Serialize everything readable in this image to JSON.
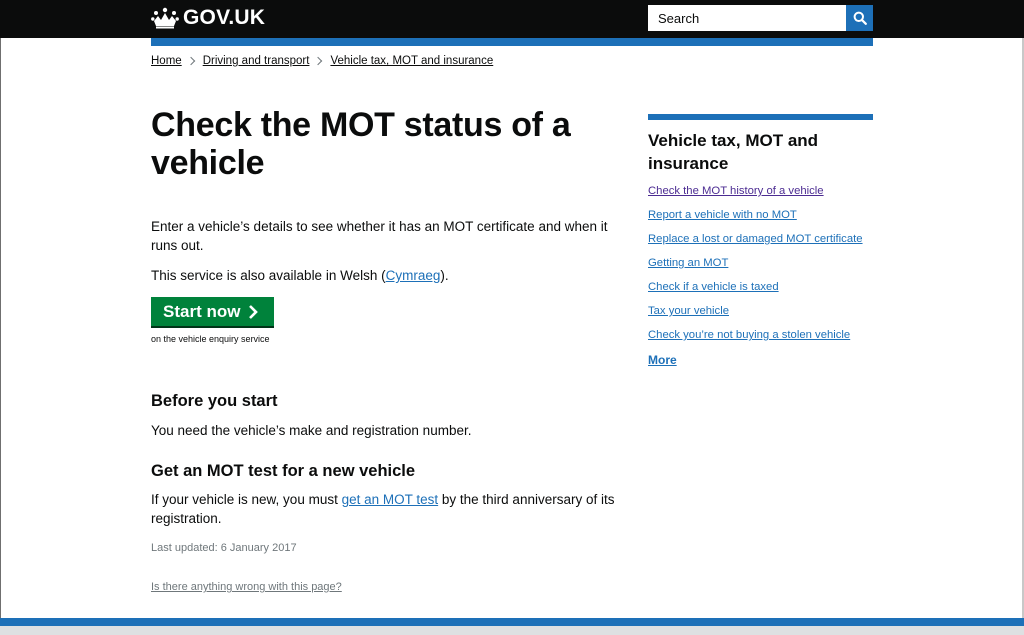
{
  "header": {
    "logo_text": "GOV.UK",
    "search_placeholder": "Search"
  },
  "breadcrumb": [
    "Home",
    "Driving and transport",
    "Vehicle tax, MOT and insurance"
  ],
  "main": {
    "title": "Check the MOT status of a vehicle",
    "intro": "Enter a vehicle’s details to see whether it has an MOT certificate and when it runs out.",
    "welsh_pre": "This service is also available in Welsh (",
    "welsh_link": "Cymraeg",
    "welsh_post": ").",
    "start_button": "Start now",
    "start_note": "on the vehicle enquiry service",
    "before_heading": "Before you start",
    "before_text": "You need the vehicle’s make and registration number.",
    "new_heading": "Get an MOT test for a new vehicle",
    "new_text_pre": "If your vehicle is new, you must ",
    "new_text_link": "get an MOT test",
    "new_text_post": " by the third anniversary of its registration.",
    "last_updated": "Last updated: 6 January 2017",
    "report_link": "Is there anything wrong with this page?"
  },
  "sidebar": {
    "title": "Vehicle tax, MOT and insurance",
    "links": [
      "Check the MOT history of a vehicle",
      "Report a vehicle with no MOT",
      "Replace a lost or damaged MOT certificate",
      "Getting an MOT",
      "Check if a vehicle is taxed",
      "Tax your vehicle",
      "Check you’re not buying a stolen vehicle"
    ],
    "more": "More"
  },
  "colors": {
    "header_bg": "#0b0c0c",
    "brand_blue": "#1d70b8",
    "start_green": "#00823b",
    "visited_link": "#4c2c92"
  },
  "icons": [
    "crown-icon",
    "search-icon",
    "chevron-right-icon"
  ]
}
